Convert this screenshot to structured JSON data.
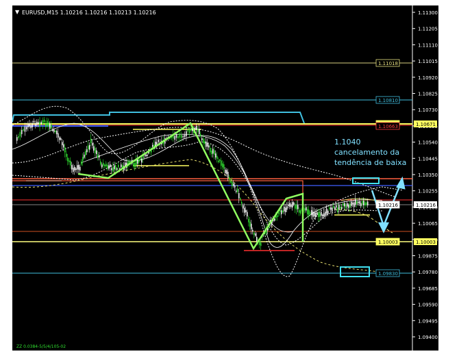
{
  "window": {
    "symbol_header": "EURUSD,M15  1.10216 1.10216 1.10213 1.10216",
    "footer_text": "ZZ 0.0384-5/5/4/105-02"
  },
  "annotation": {
    "line1": "1.1040",
    "line2": "cancelamento da",
    "line3": "tendência de baixa"
  },
  "price_axis": {
    "ticks": [
      "1.11300",
      "1.11205",
      "1.11110",
      "1.11015",
      "1.10920",
      "1.10825",
      "1.10730",
      "1.10635",
      "1.10540",
      "1.10445",
      "1.10350",
      "1.10255",
      "1.10160",
      "1.10065",
      "1.09970",
      "1.09875",
      "1.09780",
      "1.09685",
      "1.09590",
      "1.09495",
      "1.09400"
    ],
    "labels": [
      {
        "text": "1.11018",
        "bg": "#000000",
        "fg": "#e8e080",
        "border": "#e8e080"
      },
      {
        "text": "1.10810",
        "bg": "#000000",
        "fg": "#40c0e0",
        "border": "#40c0e0"
      },
      {
        "text": "1.10671",
        "bg": "#ffff60",
        "fg": "#000000",
        "border": "#ffff60"
      },
      {
        "text": "1.10663",
        "bg": "#000000",
        "fg": "#ff4040",
        "border": "#ff4040"
      },
      {
        "text": "1.10216",
        "bg": "#ffffff",
        "fg": "#000000",
        "border": "#ffffff"
      },
      {
        "text": "1.10003",
        "bg": "#ffff60",
        "fg": "#000000",
        "border": "#ffff60"
      },
      {
        "text": "1.09830",
        "bg": "#000000",
        "fg": "#40c0e0",
        "border": "#40c0e0"
      }
    ]
  },
  "colors": {
    "bg": "#000000",
    "bull": "#30e030",
    "bear": "#ffffff",
    "zigzag": "#90ff60",
    "arrow": "#80e0ff",
    "bb_outer": "#ffffff",
    "ma_yellow": "#e8e070"
  }
}
